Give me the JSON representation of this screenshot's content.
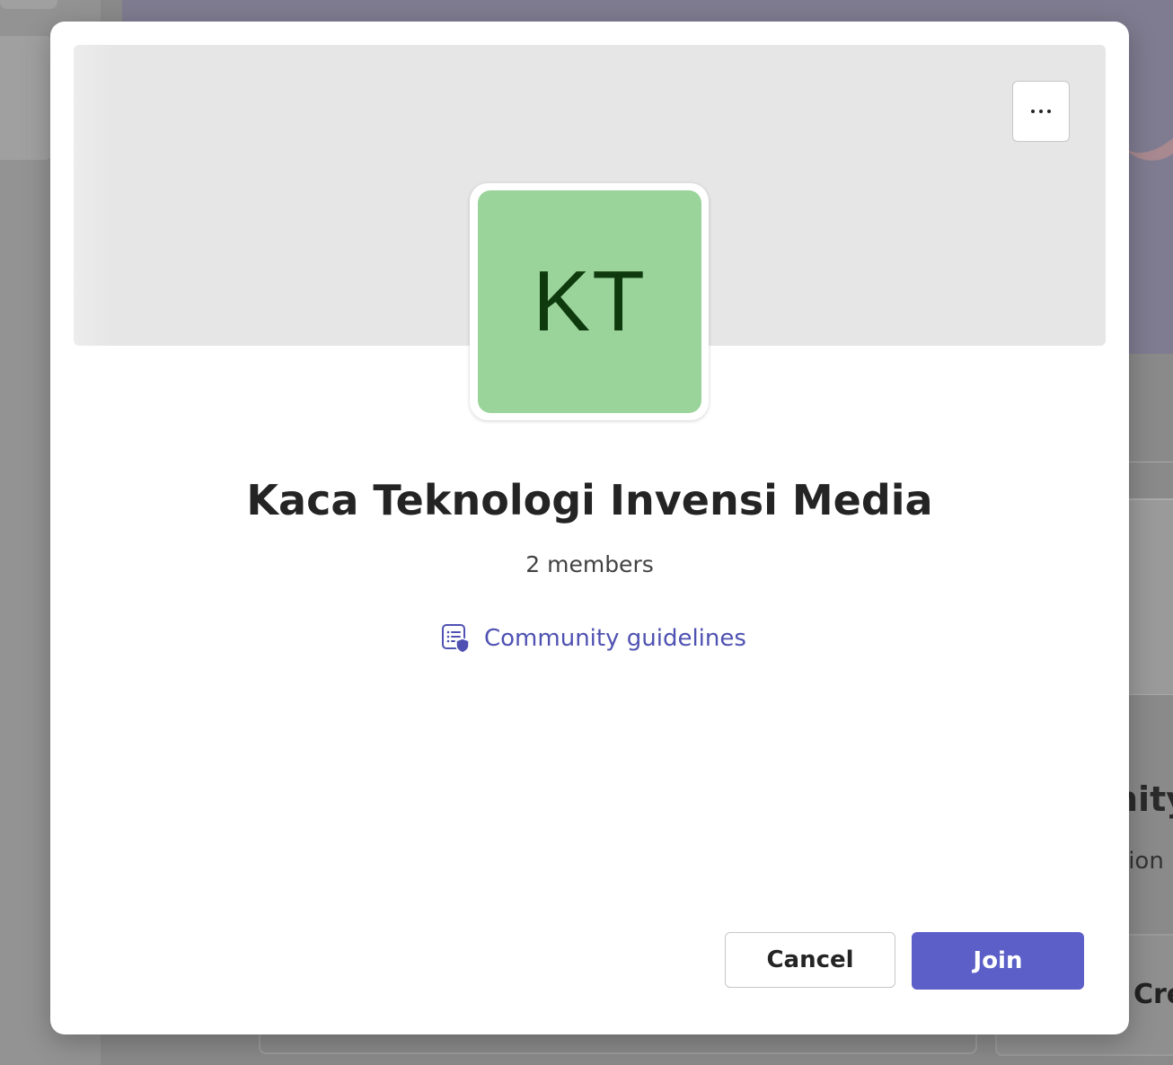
{
  "background": {
    "right_title_fragment": "nity",
    "right_subtitle_fragment": "tion",
    "right_button_fragment": "Cre"
  },
  "dialog": {
    "more_options_icon": "ellipsis-icon",
    "avatar_initials": "KT",
    "avatar_color": "#9bd49a",
    "team_name": "Kaca Teknologi Invensi Media",
    "member_count": "2 members",
    "guidelines_icon": "document-shield-icon",
    "guidelines_label": "Community guidelines",
    "cancel_label": "Cancel",
    "join_label": "Join",
    "accent_color": "#5b5fc7"
  }
}
